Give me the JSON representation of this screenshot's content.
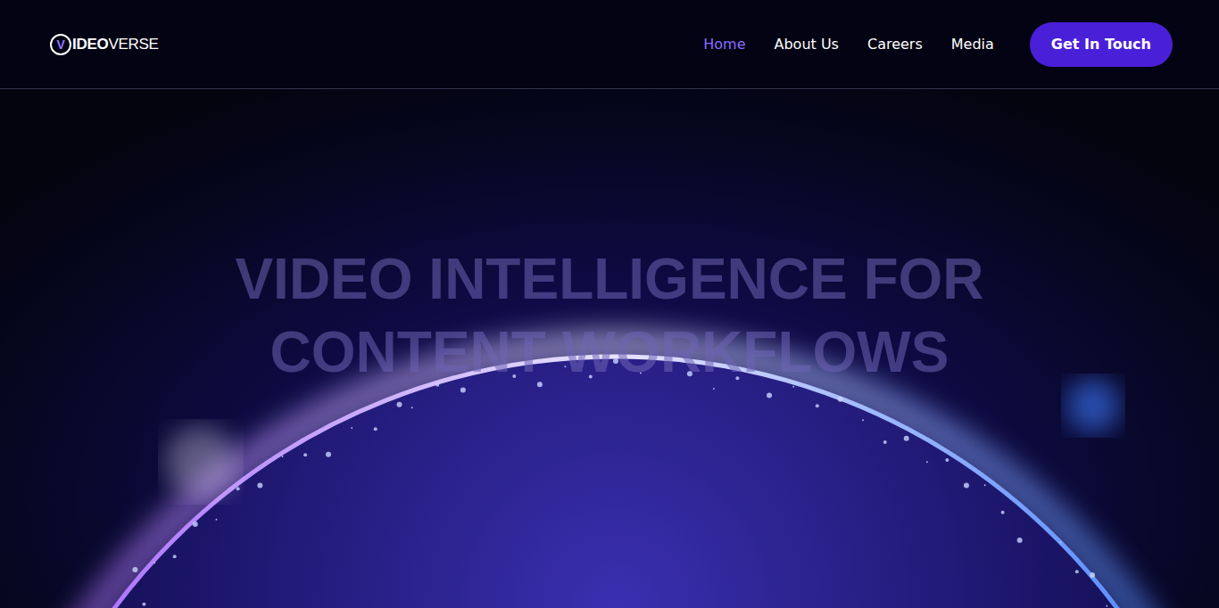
{
  "logo": {
    "mark": "V",
    "bold": "IDEO",
    "light": "VERSE"
  },
  "nav": [
    {
      "label": "Home",
      "selected": true
    },
    {
      "label": "About Us",
      "selected": false
    },
    {
      "label": "Careers",
      "selected": false
    },
    {
      "label": "Media",
      "selected": false
    }
  ],
  "cta": "Get In Touch",
  "hero": {
    "lines": [
      "VIDEO INTELLIGENCE FOR",
      "CONTENT WORKFLOWS"
    ]
  }
}
